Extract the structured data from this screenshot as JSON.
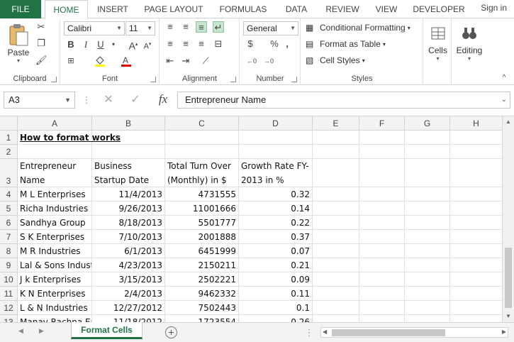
{
  "ribbon": {
    "tabs": [
      "FILE",
      "HOME",
      "INSERT",
      "PAGE LAYOUT",
      "FORMULAS",
      "DATA",
      "REVIEW",
      "VIEW",
      "DEVELOPER"
    ],
    "signin": "Sign in",
    "clipboard": {
      "label": "Clipboard",
      "paste": "Paste"
    },
    "font": {
      "label": "Font",
      "name": "Calibri",
      "size": "11",
      "bold": "B",
      "italic": "I",
      "underline": "U"
    },
    "alignment": {
      "label": "Alignment"
    },
    "number": {
      "label": "Number",
      "format": "General",
      "currency": "$",
      "percent": "%",
      "comma": ","
    },
    "styles": {
      "label": "Styles",
      "conditional": "Conditional Formatting",
      "format_table": "Format as Table",
      "cell_styles": "Cell Styles"
    },
    "cells": {
      "label": "Cells"
    },
    "editing": {
      "label": "Editing"
    }
  },
  "formula_bar": {
    "name_box": "A3",
    "fx": "fx",
    "content": "Entrepreneur Name"
  },
  "grid": {
    "columns": [
      "A",
      "B",
      "C",
      "D",
      "E",
      "F",
      "G",
      "H"
    ],
    "row_numbers": [
      "1",
      "2",
      "3",
      "4",
      "5",
      "6",
      "7",
      "8",
      "9",
      "10",
      "11",
      "12",
      "13"
    ],
    "title": "How to format works",
    "headers": [
      "Entrepreneur Name",
      "Business Startup Date",
      "Total Turn Over (Monthly) in $",
      "Growth Rate FY-2013 in %"
    ],
    "rows": [
      [
        "M L Enterprises",
        "11/4/2013",
        "4731555",
        "0.32"
      ],
      [
        "Richa Industries",
        "9/26/2013",
        "11001666",
        "0.14"
      ],
      [
        "Sandhya Group",
        "8/18/2013",
        "5501777",
        "0.22"
      ],
      [
        "S K Enterprises",
        "7/10/2013",
        "2001888",
        "0.37"
      ],
      [
        "M R Industries",
        "6/1/2013",
        "6451999",
        "0.07"
      ],
      [
        "Lal & Sons Industries",
        "4/23/2013",
        "2150211",
        "0.21"
      ],
      [
        "J k Enterprises",
        "3/15/2013",
        "2502221",
        "0.09"
      ],
      [
        "K N Enterprises",
        "2/4/2013",
        "9462332",
        "0.11"
      ],
      [
        "L & N Industries",
        "12/27/2012",
        "7502443",
        "0.1"
      ],
      [
        "Manav Rachna Enterprises",
        "11/18/2012",
        "1723554",
        "0.26"
      ]
    ]
  },
  "sheets": {
    "active": "Format Cells",
    "add": "+"
  }
}
